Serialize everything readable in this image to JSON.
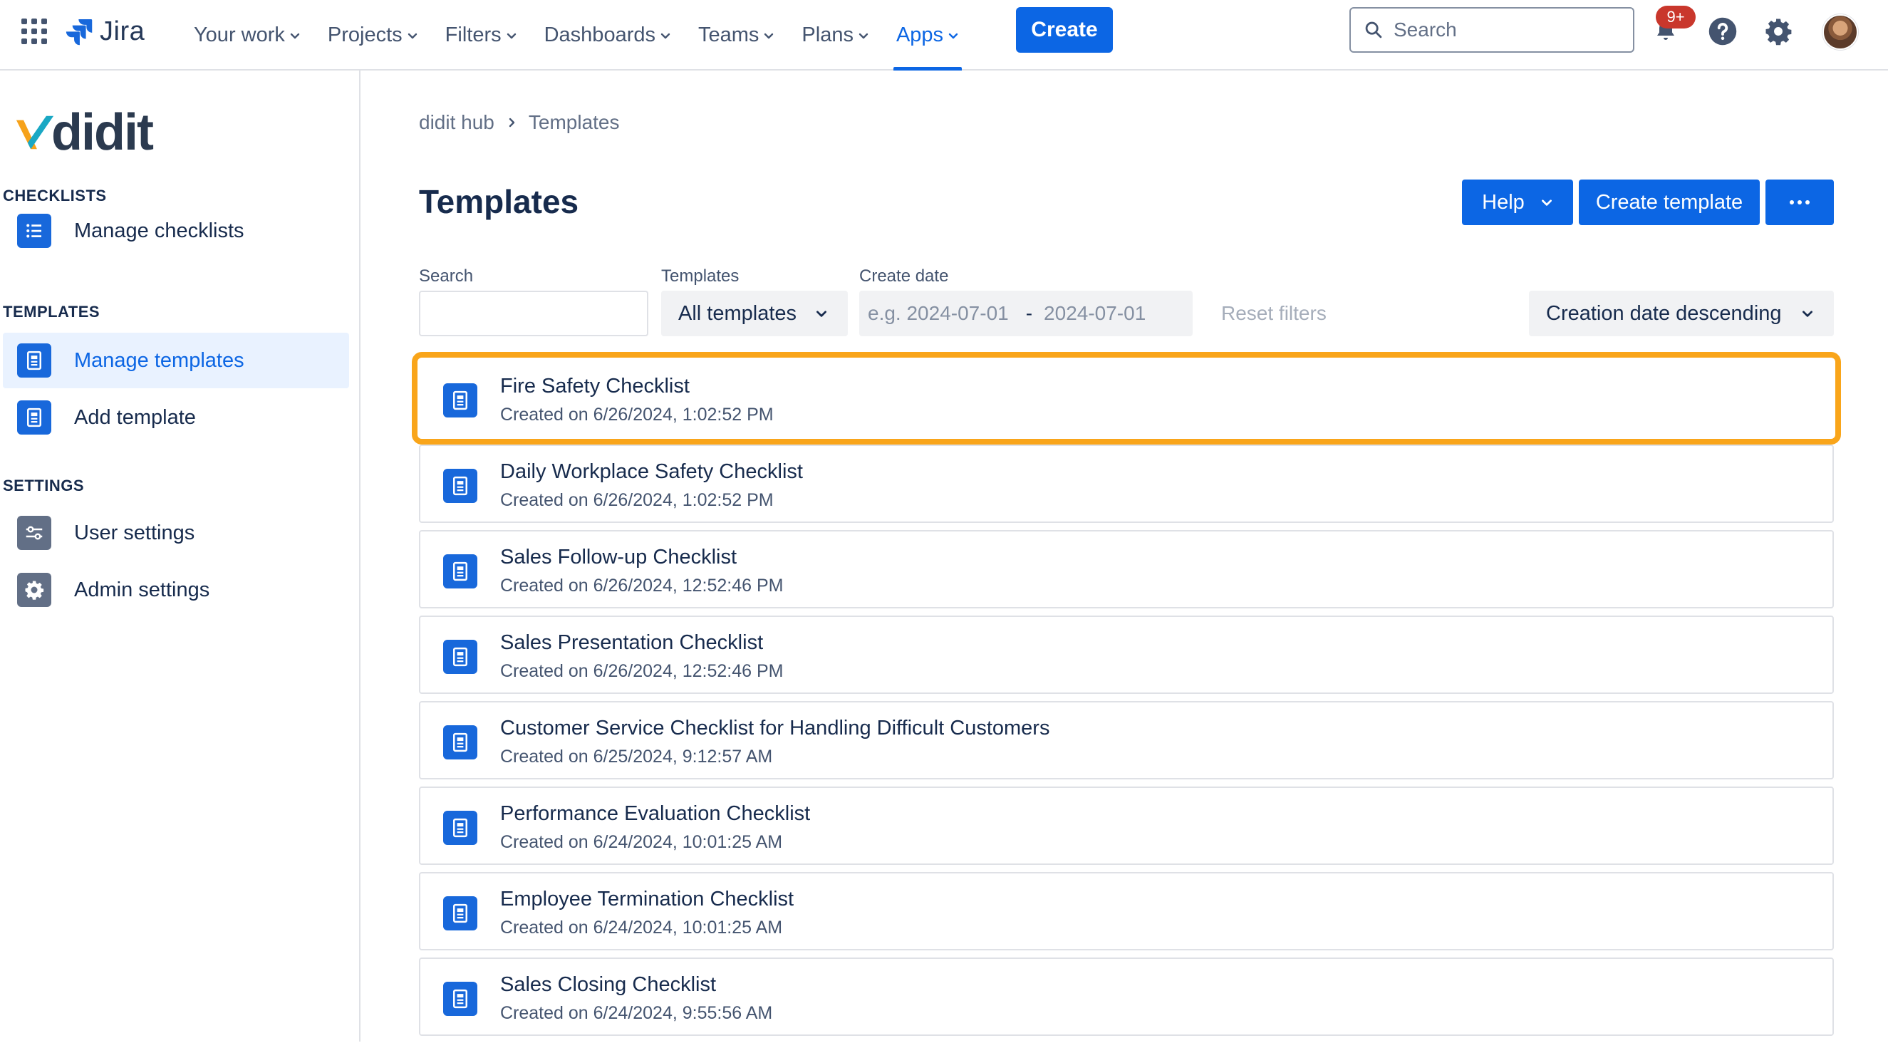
{
  "topnav": {
    "product_name": "Jira",
    "items": [
      {
        "label": "Your work"
      },
      {
        "label": "Projects"
      },
      {
        "label": "Filters"
      },
      {
        "label": "Dashboards"
      },
      {
        "label": "Teams"
      },
      {
        "label": "Plans"
      },
      {
        "label": "Apps",
        "active": true
      }
    ],
    "create_label": "Create",
    "search_placeholder": "Search",
    "notification_badge": "9+",
    "icons": [
      "app-switcher-icon",
      "notification-icon",
      "help-icon",
      "settings-icon",
      "avatar"
    ]
  },
  "sidebar": {
    "logo_text": "didit",
    "sections": [
      {
        "title": "CHECKLISTS",
        "items": [
          {
            "label": "Manage checklists",
            "icon": "list-icon"
          }
        ]
      },
      {
        "title": "TEMPLATES",
        "items": [
          {
            "label": "Manage templates",
            "icon": "document-icon",
            "selected": true
          },
          {
            "label": "Add template",
            "icon": "document-icon"
          }
        ]
      },
      {
        "title": "SETTINGS",
        "items": [
          {
            "label": "User settings",
            "icon": "sliders-icon"
          },
          {
            "label": "Admin settings",
            "icon": "gear-icon"
          }
        ]
      }
    ]
  },
  "main": {
    "breadcrumb": [
      "didit hub",
      "Templates"
    ],
    "title": "Templates",
    "actions": {
      "help_label": "Help",
      "create_template_label": "Create template",
      "more_label": "···"
    },
    "filters": {
      "search_label": "Search",
      "search_value": "",
      "templates_label": "Templates",
      "templates_value": "All templates",
      "create_date_label": "Create date",
      "date_from_placeholder": "e.g. 2024-07-01",
      "date_separator": "-",
      "date_to_placeholder": "2024-07-01",
      "reset_label": "Reset filters",
      "sort_value": "Creation date descending"
    },
    "templates": [
      {
        "title": "Fire Safety Checklist",
        "created": "Created on 6/26/2024, 1:02:52 PM",
        "highlighted": true
      },
      {
        "title": "Daily Workplace Safety Checklist",
        "created": "Created on 6/26/2024, 1:02:52 PM"
      },
      {
        "title": "Sales Follow-up Checklist",
        "created": "Created on 6/26/2024, 12:52:46 PM"
      },
      {
        "title": "Sales Presentation Checklist",
        "created": "Created on 6/26/2024, 12:52:46 PM"
      },
      {
        "title": "Customer Service Checklist for Handling Difficult Customers",
        "created": "Created on 6/25/2024, 9:12:57 AM"
      },
      {
        "title": "Performance Evaluation Checklist",
        "created": "Created on 6/24/2024, 10:01:25 AM"
      },
      {
        "title": "Employee Termination Checklist",
        "created": "Created on 6/24/2024, 10:01:25 AM"
      },
      {
        "title": "Sales Closing Checklist",
        "created": "Created on 6/24/2024, 9:55:56 AM"
      }
    ]
  },
  "colors": {
    "accent": "#0c66e4",
    "highlight": "#f9a51a",
    "badge": "#c9372c",
    "selected_bg": "#e9f2ff"
  }
}
